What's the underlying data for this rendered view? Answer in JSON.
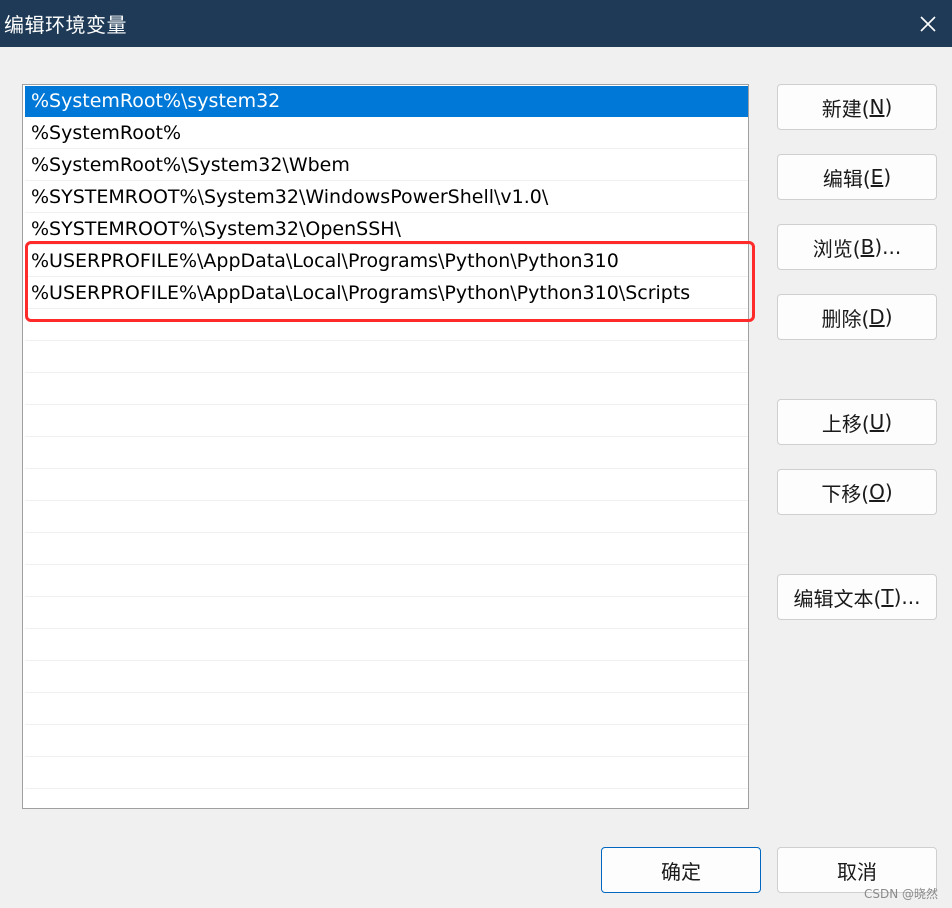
{
  "window": {
    "title": "编辑环境变量",
    "close_glyph": "✕"
  },
  "path_list": {
    "items": [
      "%SystemRoot%\\system32",
      "%SystemRoot%",
      "%SystemRoot%\\System32\\Wbem",
      "%SYSTEMROOT%\\System32\\WindowsPowerShell\\v1.0\\",
      "%SYSTEMROOT%\\System32\\OpenSSH\\",
      "%USERPROFILE%\\AppData\\Local\\Programs\\Python\\Python310",
      "%USERPROFILE%\\AppData\\Local\\Programs\\Python\\Python310\\Scripts"
    ],
    "selected_index": 0,
    "highlighted_indices": [
      5,
      6
    ],
    "empty_rows": 15
  },
  "buttons": {
    "new": {
      "pre": "新建(",
      "key": "N",
      "post": ")"
    },
    "edit": {
      "pre": "编辑(",
      "key": "E",
      "post": ")"
    },
    "browse": {
      "pre": "浏览(",
      "key": "B",
      "post": ")..."
    },
    "delete": {
      "pre": "删除(",
      "key": "D",
      "post": ")"
    },
    "move_up": {
      "pre": "上移(",
      "key": "U",
      "post": ")"
    },
    "move_down": {
      "pre": "下移(",
      "key": "O",
      "post": ")"
    },
    "edit_text": {
      "pre": "编辑文本(",
      "key": "T",
      "post": ")..."
    },
    "ok": "确定",
    "cancel": "取消"
  },
  "watermark": "CSDN @晓然",
  "colors": {
    "titlebar": "#1e3a56",
    "selection": "#0078d7",
    "highlight_box": "#ff2a2a",
    "default_button_border": "#0067c0"
  }
}
